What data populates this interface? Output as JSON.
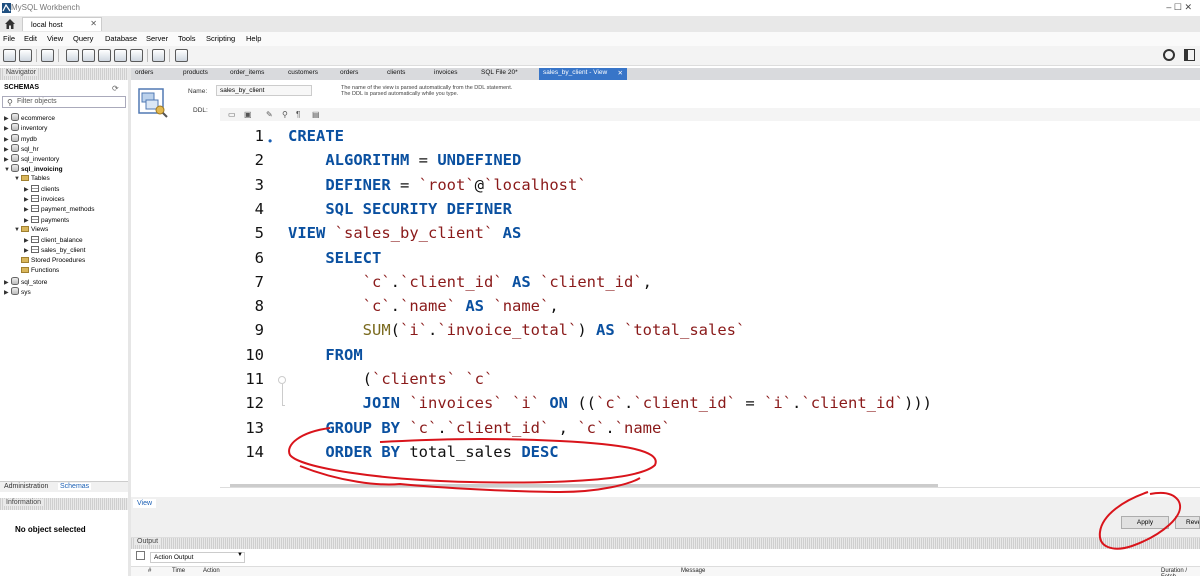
{
  "window": {
    "title": "MySQL Workbench",
    "controls": "–     ☐     ✕"
  },
  "connection_tab": {
    "label": "local host",
    "close": "✕"
  },
  "menu": [
    "File",
    "Edit",
    "View",
    "Query",
    "Database",
    "Server",
    "Tools",
    "Scripting",
    "Help"
  ],
  "navigator": {
    "header": "Navigator",
    "schemas_title": "SCHEMAS",
    "refresh_glyph": "⟳",
    "filter_placeholder": "Filter objects",
    "tree": [
      {
        "label": "ecommerce",
        "level": 0,
        "kind": "db",
        "arrow": "▶"
      },
      {
        "label": "inventory",
        "level": 0,
        "kind": "db",
        "arrow": "▶"
      },
      {
        "label": "mydb",
        "level": 0,
        "kind": "db",
        "arrow": "▶"
      },
      {
        "label": "sql_hr",
        "level": 0,
        "kind": "db",
        "arrow": "▶"
      },
      {
        "label": "sql_inventory",
        "level": 0,
        "kind": "db",
        "arrow": "▶"
      },
      {
        "label": "sql_invoicing",
        "level": 0,
        "kind": "db",
        "arrow": "▼",
        "bold": true
      },
      {
        "label": "Tables",
        "level": 1,
        "kind": "folder",
        "arrow": "▼"
      },
      {
        "label": "clients",
        "level": 2,
        "kind": "table",
        "arrow": "▶"
      },
      {
        "label": "invoices",
        "level": 2,
        "kind": "table",
        "arrow": "▶"
      },
      {
        "label": "payment_methods",
        "level": 2,
        "kind": "table",
        "arrow": "▶"
      },
      {
        "label": "payments",
        "level": 2,
        "kind": "table",
        "arrow": "▶"
      },
      {
        "label": "Views",
        "level": 1,
        "kind": "folder",
        "arrow": "▼"
      },
      {
        "label": "client_balance",
        "level": 2,
        "kind": "table",
        "arrow": "▶"
      },
      {
        "label": "sales_by_client",
        "level": 2,
        "kind": "table",
        "arrow": "▶"
      },
      {
        "label": "Stored Procedures",
        "level": 1,
        "kind": "folder",
        "arrow": ""
      },
      {
        "label": "Functions",
        "level": 1,
        "kind": "folder",
        "arrow": ""
      },
      {
        "label": "sql_store",
        "level": 0,
        "kind": "db",
        "arrow": "▶"
      },
      {
        "label": "sys",
        "level": 0,
        "kind": "db",
        "arrow": "▶"
      }
    ],
    "bottom_tabs": {
      "administration": "Administration",
      "schemas": "Schemas"
    },
    "info_header": "Information",
    "no_object": "No object selected"
  },
  "editor_tabs": [
    "orders",
    "products",
    "order_items",
    "customers",
    "orders",
    "clients",
    "invoices",
    "SQL File 20*"
  ],
  "active_tab": {
    "label": "sales_by_client - View",
    "close": "✕"
  },
  "view_editor": {
    "name_label": "Name:",
    "name_value": "sales_by_client",
    "name_help": "The name of the view is parsed automatically from the DDL statement. The DDL is parsed automatically while you type.",
    "ddl_label": "DDL:",
    "subtab": "View",
    "apply_label": "Apply",
    "revert_label": "Revert"
  },
  "code_lines": [
    {
      "n": "1",
      "bullet": "•",
      "html": "<span class=\"kw\">CREATE</span>"
    },
    {
      "n": "2",
      "html": "    <span class=\"kw\">ALGORITHM</span> = <span class=\"kw\">UNDEFINED</span>"
    },
    {
      "n": "3",
      "html": "    <span class=\"kw\">DEFINER</span> = <span class=\"id\">`root`</span>@<span class=\"id\">`localhost`</span>"
    },
    {
      "n": "4",
      "html": "    <span class=\"kw\">SQL SECURITY DEFINER</span>"
    },
    {
      "n": "5",
      "html": "<span class=\"kw\">VIEW</span> <span class=\"id\">`sales_by_client`</span> <span class=\"kw\">AS</span>"
    },
    {
      "n": "6",
      "html": "    <span class=\"kw\">SELECT</span>"
    },
    {
      "n": "7",
      "html": "        <span class=\"id\">`c`</span>.<span class=\"id\">`client_id`</span> <span class=\"kw\">AS</span> <span class=\"id\">`client_id`</span>,"
    },
    {
      "n": "8",
      "html": "        <span class=\"id\">`c`</span>.<span class=\"id\">`name`</span> <span class=\"kw\">AS</span> <span class=\"id\">`name`</span>,"
    },
    {
      "n": "9",
      "html": "        <span class=\"fn\">SUM</span>(<span class=\"id\">`i`</span>.<span class=\"id\">`invoice_total`</span>) <span class=\"kw\">AS</span> <span class=\"id\">`total_sales`</span>"
    },
    {
      "n": "10",
      "html": "    <span class=\"kw\">FROM</span>"
    },
    {
      "n": "11",
      "html": "        (<span class=\"id\">`clients`</span> <span class=\"id\">`c`</span>"
    },
    {
      "n": "12",
      "html": "        <span class=\"kw\">JOIN</span> <span class=\"id\">`invoices`</span> <span class=\"id\">`i`</span> <span class=\"kw\">ON</span> ((<span class=\"id\">`c`</span>.<span class=\"id\">`client_id`</span> = <span class=\"id\">`i`</span>.<span class=\"id\">`client_id`</span>)))"
    },
    {
      "n": "13",
      "html": "    <span class=\"kw\">GROUP BY</span> <span class=\"id\">`c`</span>.<span class=\"id\">`client_id`</span> , <span class=\"id\">`c`</span>.<span class=\"id\">`name`</span>"
    },
    {
      "n": "14",
      "html": "    <span class=\"kw\">ORDER BY</span> total_sales <span class=\"kw\">DESC</span>"
    }
  ],
  "output": {
    "header": "Output",
    "selector": "Action Output",
    "columns": [
      "#",
      "Time",
      "Action",
      "Message",
      "Duration / Fetch"
    ]
  },
  "colors": {
    "accent": "#3875c8",
    "keyword": "#0a50a0",
    "identifier": "#8a1a1a",
    "annotation": "#d9141b"
  }
}
